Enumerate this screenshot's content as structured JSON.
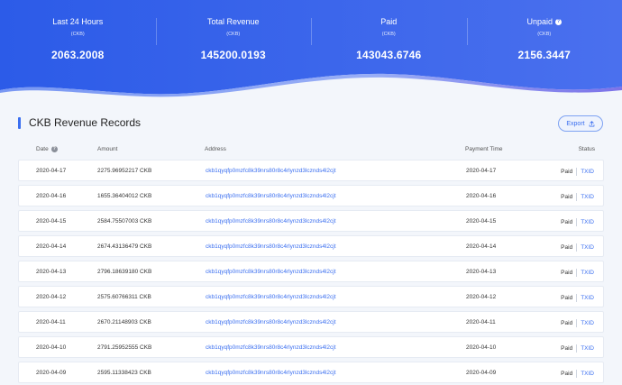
{
  "colors": {
    "brand": "#3b6ff0",
    "banner_start": "#2f5ee9",
    "banner_end": "#5a7cf0"
  },
  "stats": [
    {
      "title": "Last 24 Hours",
      "unit": "(CKB)",
      "value": "2063.2008"
    },
    {
      "title": "Total Revenue",
      "unit": "(CKB)",
      "value": "145200.0193"
    },
    {
      "title": "Paid",
      "unit": "(CKB)",
      "value": "143043.6746"
    },
    {
      "title": "Unpaid",
      "unit": "(CKB)",
      "value": "2156.3447",
      "icon": "info-icon"
    }
  ],
  "section": {
    "title": "CKB Revenue Records",
    "export_label": "Export",
    "export_icon": "upload-icon"
  },
  "table": {
    "headers": {
      "date": "Date",
      "amount": "Amount",
      "address": "Address",
      "payment_time": "Payment Time",
      "status": "Status"
    },
    "rows": [
      {
        "date": "2020-04-17",
        "amount": "2275.96952217 CKB",
        "address": "ckb1qyqfp0mzfc8k39nrs80r8c4rlynzd3lcznds4l2cjt",
        "payment_time": "2020-04-17",
        "status": "Paid",
        "txid": "TXID"
      },
      {
        "date": "2020-04-16",
        "amount": "1655.36404012 CKB",
        "address": "ckb1qyqfp0mzfc8k39nrs80r8c4rlynzd3lcznds4l2cjt",
        "payment_time": "2020-04-16",
        "status": "Paid",
        "txid": "TXID"
      },
      {
        "date": "2020-04-15",
        "amount": "2584.75507003 CKB",
        "address": "ckb1qyqfp0mzfc8k39nrs80r8c4rlynzd3lcznds4l2cjt",
        "payment_time": "2020-04-15",
        "status": "Paid",
        "txid": "TXID"
      },
      {
        "date": "2020-04-14",
        "amount": "2674.43136479 CKB",
        "address": "ckb1qyqfp0mzfc8k39nrs80r8c4rlynzd3lcznds4l2cjt",
        "payment_time": "2020-04-14",
        "status": "Paid",
        "txid": "TXID"
      },
      {
        "date": "2020-04-13",
        "amount": "2796.18639180 CKB",
        "address": "ckb1qyqfp0mzfc8k39nrs80r8c4rlynzd3lcznds4l2cjt",
        "payment_time": "2020-04-13",
        "status": "Paid",
        "txid": "TXID"
      },
      {
        "date": "2020-04-12",
        "amount": "2575.60766311 CKB",
        "address": "ckb1qyqfp0mzfc8k39nrs80r8c4rlynzd3lcznds4l2cjt",
        "payment_time": "2020-04-12",
        "status": "Paid",
        "txid": "TXID"
      },
      {
        "date": "2020-04-11",
        "amount": "2670.21148903 CKB",
        "address": "ckb1qyqfp0mzfc8k39nrs80r8c4rlynzd3lcznds4l2cjt",
        "payment_time": "2020-04-11",
        "status": "Paid",
        "txid": "TXID"
      },
      {
        "date": "2020-04-10",
        "amount": "2791.25952555 CKB",
        "address": "ckb1qyqfp0mzfc8k39nrs80r8c4rlynzd3lcznds4l2cjt",
        "payment_time": "2020-04-10",
        "status": "Paid",
        "txid": "TXID"
      },
      {
        "date": "2020-04-09",
        "amount": "2595.11338423 CKB",
        "address": "ckb1qyqfp0mzfc8k39nrs80r8c4rlynzd3lcznds4l2cjt",
        "payment_time": "2020-04-09",
        "status": "Paid",
        "txid": "TXID"
      }
    ]
  }
}
